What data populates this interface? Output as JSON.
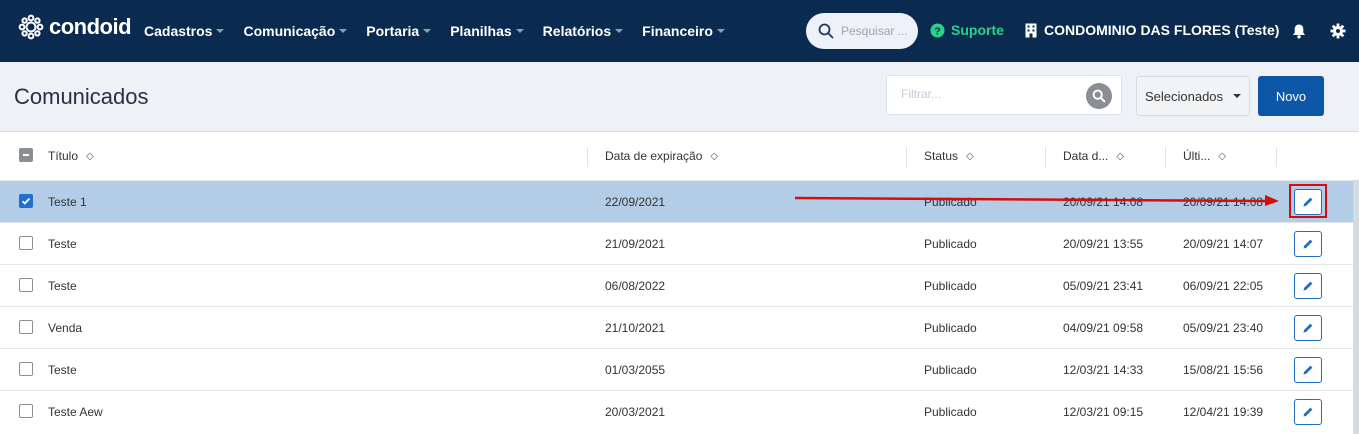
{
  "nav": {
    "brand": "condoid",
    "menu": [
      "Cadastros",
      "Comunicação",
      "Portaria",
      "Planilhas",
      "Relatórios",
      "Financeiro"
    ],
    "search_placeholder": "Pesquisar ...",
    "support_label": "Suporte",
    "condo_name": "CONDOMINIO DAS FLORES (Teste)"
  },
  "page": {
    "title": "Comunicados",
    "filter_placeholder": "Filtrar...",
    "selected_label": "Selecionados",
    "new_label": "Novo"
  },
  "table": {
    "columns": [
      "Título",
      "Data de expiração",
      "Status",
      "Data d...",
      "Últi..."
    ],
    "rows": [
      {
        "title": "Teste 1",
        "expiration": "22/09/2021",
        "status": "Publicado",
        "created": "20/09/21 14:08",
        "updated": "20/09/21 14:08",
        "checked": true
      },
      {
        "title": "Teste",
        "expiration": "21/09/2021",
        "status": "Publicado",
        "created": "20/09/21 13:55",
        "updated": "20/09/21 14:07",
        "checked": false
      },
      {
        "title": "Teste",
        "expiration": "06/08/2022",
        "status": "Publicado",
        "created": "05/09/21 23:41",
        "updated": "06/09/21 22:05",
        "checked": false
      },
      {
        "title": "Venda",
        "expiration": "21/10/2021",
        "status": "Publicado",
        "created": "04/09/21 09:58",
        "updated": "05/09/21 23:40",
        "checked": false
      },
      {
        "title": "Teste",
        "expiration": "01/03/2055",
        "status": "Publicado",
        "created": "12/03/21 14:33",
        "updated": "15/08/21 15:56",
        "checked": false
      },
      {
        "title": "Teste Aew",
        "expiration": "20/03/2021",
        "status": "Publicado",
        "created": "12/03/21 09:15",
        "updated": "12/04/21 19:39",
        "checked": false
      }
    ]
  },
  "colors": {
    "navbar": "#0a2a4f",
    "primary": "#0d57a6",
    "support": "#29d28a",
    "selected_row": "#b3cde6",
    "annotation": "#d60d0d"
  }
}
